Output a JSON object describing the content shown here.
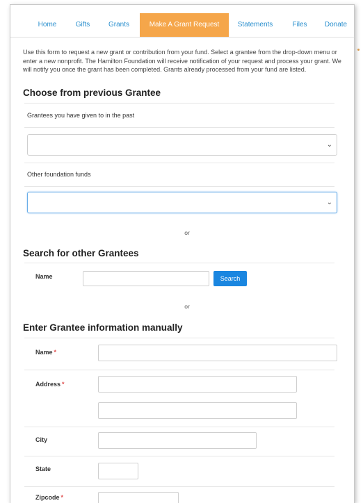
{
  "nav": {
    "tabs": [
      {
        "label": "Home"
      },
      {
        "label": "Gifts"
      },
      {
        "label": "Grants"
      },
      {
        "label": "Make A Grant Request"
      },
      {
        "label": "Statements"
      },
      {
        "label": "Files"
      },
      {
        "label": "Donate"
      }
    ],
    "active_tab": "Make A Grant Request"
  },
  "intro_text": "Use this form to request a new grant or contribution from your fund. Select a grantee from the drop-down menu or enter a new nonprofit. The Hamilton Foundation will receive notification of your request and process your grant. We will notify you once the grant has been completed. Grants already processed from your fund are listed.",
  "previous": {
    "heading": "Choose from previous Grantee",
    "past_label": "Grantees you have given to in the past",
    "past_value": "",
    "other_label": "Other foundation funds",
    "other_value": ""
  },
  "or_text": "or",
  "search": {
    "heading": "Search for other Grantees",
    "name_label": "Name",
    "name_value": "",
    "button_label": "Search"
  },
  "manual": {
    "heading": "Enter Grantee information manually",
    "required_marker": "*",
    "fields": {
      "name": {
        "label": "Name",
        "value": ""
      },
      "address": {
        "label": "Address",
        "value": "",
        "value2": ""
      },
      "city": {
        "label": "City",
        "value": ""
      },
      "state": {
        "label": "State",
        "value": ""
      },
      "zipcode": {
        "label": "Zipcode",
        "value": ""
      }
    }
  },
  "colors": {
    "accent": "#f5a64a",
    "link": "#2a8fce",
    "button": "#1a86e0",
    "required": "#e05050"
  }
}
